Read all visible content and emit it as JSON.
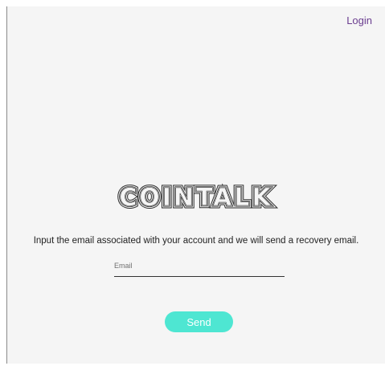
{
  "header": {
    "login_label": "Login"
  },
  "brand": {
    "logo_text": "COINTALK"
  },
  "recovery": {
    "message": "Input the email associated with your account and we will send a recovery email.",
    "email_placeholder": "Email",
    "email_value": "",
    "send_label": "Send"
  },
  "colors": {
    "background": "#f5f5f5",
    "link": "#6a3d8f",
    "button": "#4ee6d2",
    "button_text": "#ffffff",
    "logo_stroke": "#2b2b2b"
  }
}
